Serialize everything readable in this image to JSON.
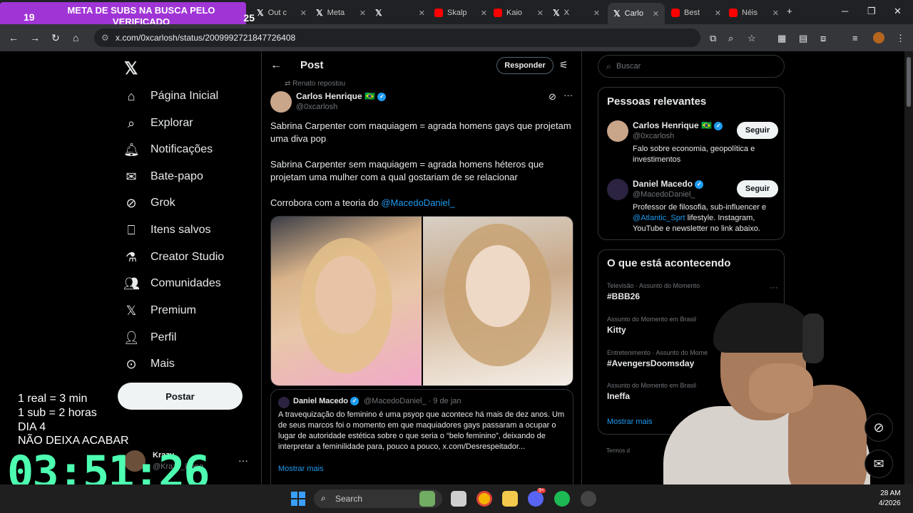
{
  "overlay": {
    "count": "19",
    "banner": "META DE SUBS NA BUSCA PELO VERIFICADO",
    "goal": "25",
    "rules": [
      "1 real = 3 min",
      "1 sub = 2 horas",
      "DIA 4",
      "NÃO DEIXA ACABAR"
    ],
    "timer": "03:51:26"
  },
  "browser": {
    "tabs": [
      {
        "label": "Out c",
        "icon": "x-icon"
      },
      {
        "label": "Meta",
        "icon": "x-icon"
      },
      {
        "label": "",
        "icon": "x-icon"
      },
      {
        "label": "Skalp",
        "icon": "youtube-icon"
      },
      {
        "label": "Kaio",
        "icon": "youtube-icon"
      },
      {
        "label": "X",
        "icon": "x-icon"
      },
      {
        "label": "Carlo",
        "icon": "x-icon",
        "active": true
      },
      {
        "label": "Best",
        "icon": "youtube-icon"
      },
      {
        "label": "Néis",
        "icon": "youtube-icon"
      }
    ],
    "url": "x.com/0xcarlosh/status/2009992721847726408"
  },
  "sidebar": {
    "items": [
      {
        "label": "Página Inicial",
        "icon": "home-icon"
      },
      {
        "label": "Explorar",
        "icon": "search-icon"
      },
      {
        "label": "Notificações",
        "icon": "bell-icon"
      },
      {
        "label": "Bate-papo",
        "icon": "mail-icon"
      },
      {
        "label": "Grok",
        "icon": "grok-icon"
      },
      {
        "label": "Itens salvos",
        "icon": "bookmark-icon"
      },
      {
        "label": "Creator Studio",
        "icon": "flask-icon"
      },
      {
        "label": "Comunidades",
        "icon": "people-icon"
      },
      {
        "label": "Premium",
        "icon": "x-icon"
      },
      {
        "label": "Perfil",
        "icon": "person-icon"
      },
      {
        "label": "Mais",
        "icon": "more-circle-icon"
      }
    ],
    "post_button": "Postar",
    "account": {
      "name": "Krazy",
      "handle": "@Krazy_Pong"
    }
  },
  "post": {
    "header_title": "Post",
    "reply_button": "Responder",
    "repost_line": "Renato repostou",
    "author": {
      "name": "Carlos Henrique 🇧🇷",
      "handle": "@0xcarlosh"
    },
    "paragraphs": [
      "Sabrina Carpenter com maquiagem = agrada homens gays que projetam uma diva pop",
      "Sabrina Carpenter sem maquiagem = agrada homens héteros que projetam uma mulher com a qual gostariam de se relacionar"
    ],
    "corrobora_prefix": "Corrobora com a teoria do ",
    "corrobora_mention": "@MacedoDaniel_",
    "quote": {
      "name": "Daniel Macedo",
      "handle": "@MacedoDaniel_ · 9 de jan",
      "text": "A travequização do feminino é uma psyop que acontece há mais de dez anos. Um de seus marcos foi o momento em que maquiadores gays passaram a ocupar o lugar de autoridade estética sobre o que seria o “belo feminino”, deixando de interpretar a feminilidade para, pouco a pouco, x.com/Desrespeitador...",
      "more": "Mostrar mais"
    }
  },
  "right": {
    "search_placeholder": "Buscar",
    "relevant_title": "Pessoas relevantes",
    "people": [
      {
        "name": "Carlos Henrique 🇧🇷",
        "handle": "@0xcarlosh",
        "bio": "Falo sobre economia, geopolítica e investimentos",
        "follow": "Seguir"
      },
      {
        "name": "Daniel Macedo",
        "handle": "@MacedoDaniel_",
        "bio_prefix": "Professor de filosofia, sub-influencer e ",
        "bio_mention": "@Atlantic_Sprt",
        "bio_suffix": " lifestyle. Instagram, YouTube e newsletter no link abaixo.",
        "follow": "Seguir"
      }
    ],
    "trending_title": "O que está acontecendo",
    "trends": [
      {
        "category": "Televisão · Assunto do Momento",
        "name": "#BBB26"
      },
      {
        "category": "Assunto do Momento em Brasil",
        "name": "Kitty"
      },
      {
        "category": "Entretenimento · Assunto do Mome",
        "name": "#AvengersDoomsday"
      },
      {
        "category": "Assunto do Momento em Brasil",
        "name": "Ineffa"
      }
    ],
    "show_more": "Mostrar mais",
    "footer_fragment": "Termos d"
  },
  "taskbar": {
    "search": "Search",
    "clock_time": "28 AM",
    "clock_date": "4/2026",
    "badge": "9+"
  }
}
